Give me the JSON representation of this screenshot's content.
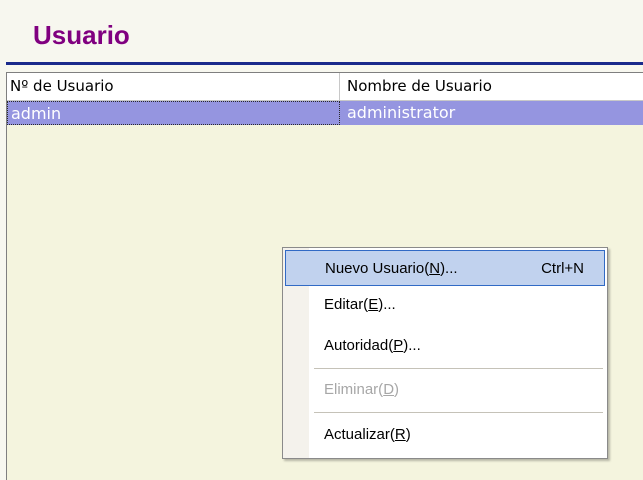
{
  "title": "Usuario",
  "table": {
    "columns": [
      "Nº de Usuario",
      "Nombre de Usuario"
    ],
    "rows": [
      {
        "id": "admin",
        "name": "administrator",
        "selected": true
      }
    ]
  },
  "context_menu": {
    "items": [
      {
        "label": "Nuevo Usuario(N)...",
        "shortcut": "Ctrl+N",
        "highlighted": true,
        "enabled": true
      },
      {
        "label": "Editar(E)...",
        "enabled": true
      },
      {
        "label": "Autoridad(P)...",
        "enabled": true
      },
      {
        "label": "Eliminar(D)",
        "enabled": false
      },
      {
        "label": "Actualizar(R)",
        "enabled": true
      }
    ]
  },
  "colors": {
    "title": "#800080",
    "title_rule": "#1a2a8c",
    "selection": "#9595e0",
    "menu_highlight": "#c1d2ee",
    "background": "#f4f4de"
  }
}
